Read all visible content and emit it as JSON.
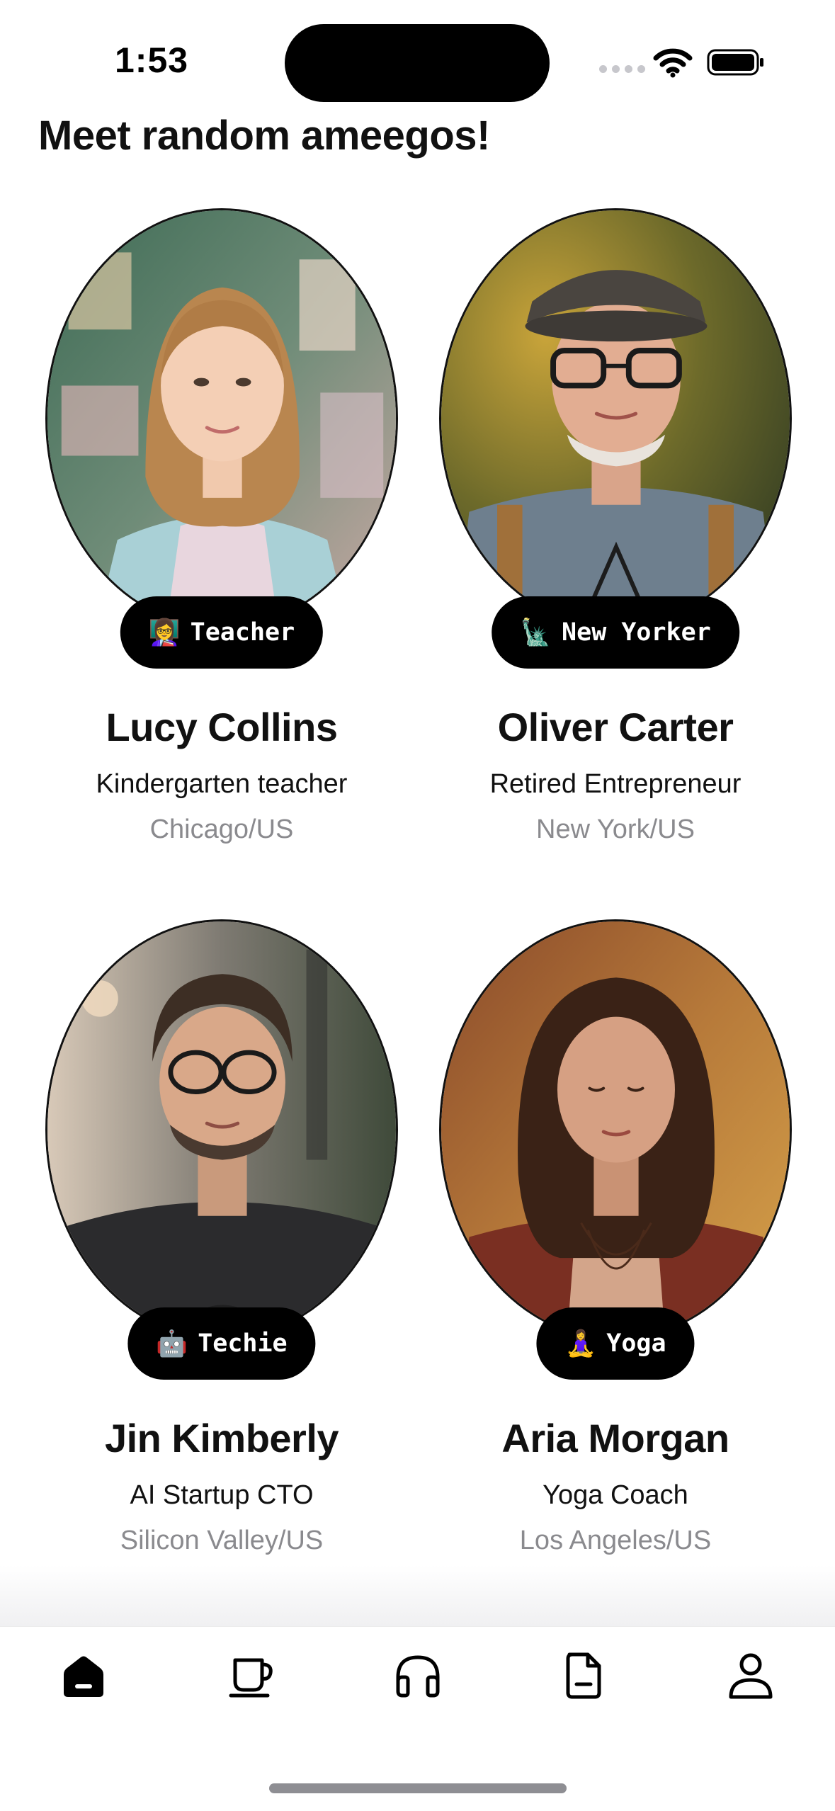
{
  "status_bar": {
    "time": "1:53"
  },
  "page": {
    "title": "Meet random ameegos!"
  },
  "profiles": [
    {
      "name": "Lucy Collins",
      "role": "Kindergarten teacher",
      "location": "Chicago/US",
      "badge_emoji": "👩‍🏫",
      "badge_label": "Teacher"
    },
    {
      "name": "Oliver Carter",
      "role": "Retired Entrepreneur",
      "location": "New York/US",
      "badge_emoji": "🗽",
      "badge_label": "New Yorker"
    },
    {
      "name": "Jin Kimberly",
      "role": "AI Startup CTO",
      "location": "Silicon Valley/US",
      "badge_emoji": "🤖",
      "badge_label": "Techie"
    },
    {
      "name": "Aria Morgan",
      "role": "Yoga Coach",
      "location": "Los Angeles/US",
      "badge_emoji": "🧘‍♀️",
      "badge_label": "Yoga"
    }
  ],
  "nav": {
    "tabs": [
      {
        "icon": "home-icon",
        "active": true
      },
      {
        "icon": "coffee-cup-icon",
        "active": false
      },
      {
        "icon": "headphones-icon",
        "active": false
      },
      {
        "icon": "document-icon",
        "active": false
      },
      {
        "icon": "profile-icon",
        "active": false
      }
    ]
  }
}
